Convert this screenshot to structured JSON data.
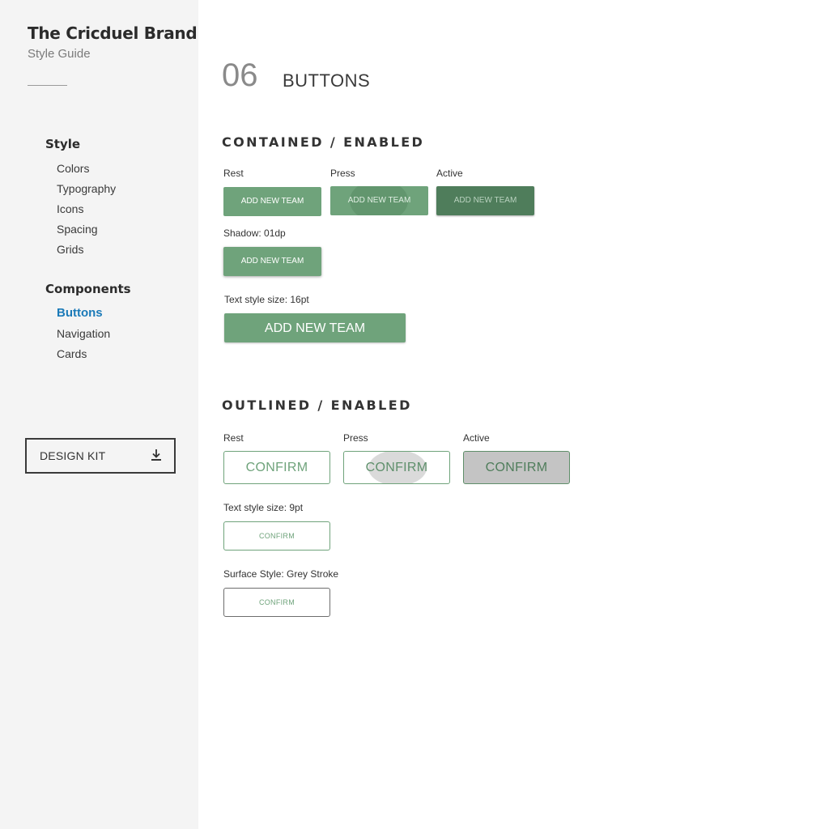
{
  "sidebar": {
    "brand_title": "The Cricduel Brand",
    "brand_subtitle": "Style Guide",
    "style_heading": "Style",
    "style_items": [
      "Colors",
      "Typography",
      "Icons",
      "Spacing",
      "Grids"
    ],
    "components_heading": "Components",
    "components_items": [
      "Buttons",
      "Navigation",
      "Cards"
    ],
    "active_item": "Buttons",
    "design_kit_label": "DESIGN KIT",
    "design_kit_icon": "download-icon"
  },
  "main": {
    "section_number": "06",
    "section_title": "BUTTONS",
    "contained": {
      "title": "CONTAINED / ENABLED",
      "rest_label": "Rest",
      "press_label": "Press",
      "active_label": "Active",
      "shadow_label": "Shadow: 01dp",
      "text_size_label": "Text style size: 16pt",
      "button_label": "ADD NEW TEAM"
    },
    "outlined": {
      "title": "OUTLINED / ENABLED",
      "rest_label": "Rest",
      "press_label": "Press",
      "active_label": "Active",
      "text_size_label": "Text style size: 9pt",
      "surface_label": "Surface Style: Grey Stroke",
      "button_label": "CONFIRM"
    }
  },
  "colors": {
    "primary_green": "#6fa37b",
    "active_green": "#4f7d5b",
    "link_blue": "#1b7ab8",
    "sidebar_bg": "#f4f4f4"
  }
}
